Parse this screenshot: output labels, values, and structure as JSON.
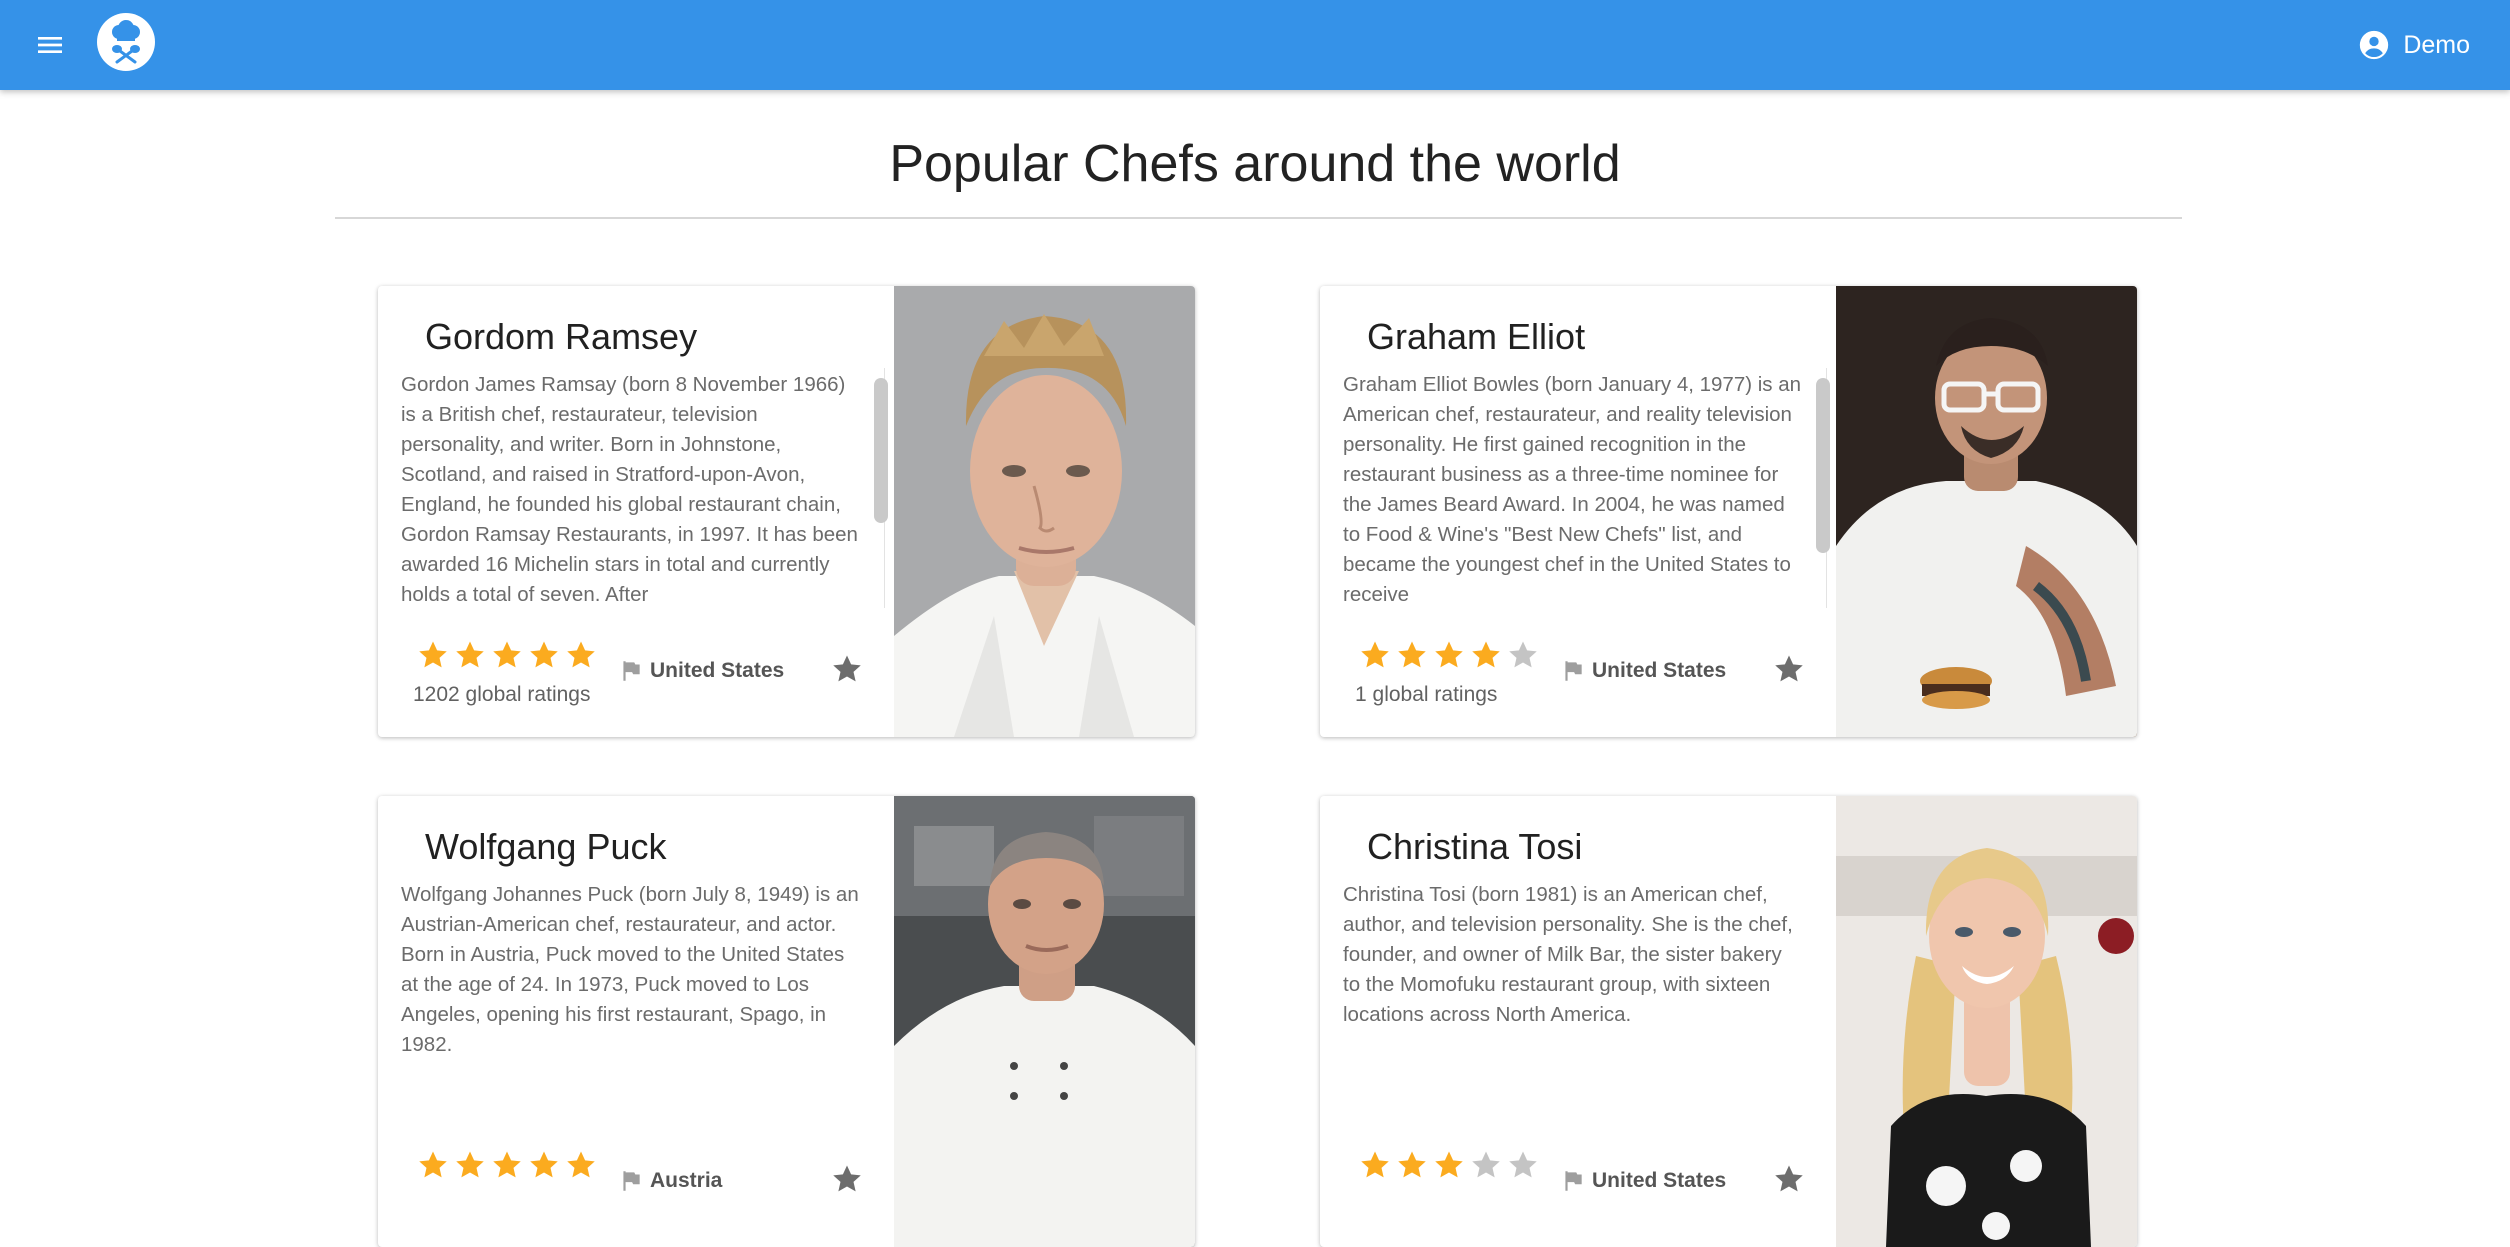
{
  "app": {
    "user_name": "Demo",
    "brand_color": "#3592e8",
    "star_color": "#fbab1f",
    "star_empty_color": "#c4c4c4"
  },
  "page": {
    "title": "Popular Chefs around the world"
  },
  "chefs": [
    {
      "name": "Gordom Ramsey",
      "bio": "Gordon James Ramsay (born 8 November 1966) is a British chef, restaurateur, television personality, and writer. Born in Johnstone, Scotland, and raised in Stratford-upon-Avon, England, he founded his global restaurant chain, Gordon Ramsay Restaurants, in 1997. It has been awarded 16 Michelin stars in total and currently holds a total of seven. After",
      "rating": 5,
      "ratings_text": "1202 global ratings",
      "country": "United States",
      "scrollable": true
    },
    {
      "name": "Graham Elliot",
      "bio": "Graham Elliot Bowles (born January 4, 1977) is an American chef, restaurateur, and reality television personality. He first gained recognition in the restaurant business as a three-time nominee for the James Beard Award. In 2004, he was named to Food & Wine's \"Best New Chefs\" list, and became the youngest chef in the United States to receive",
      "rating": 4,
      "ratings_text": "1 global ratings",
      "country": "United States",
      "scrollable": true
    },
    {
      "name": "Wolfgang Puck",
      "bio": "Wolfgang Johannes Puck (born July 8, 1949) is an Austrian-American chef, restaurateur, and actor. Born in Austria, Puck moved to the United States at the age of 24. In 1973, Puck moved to Los Angeles, opening his first restaurant, Spago, in 1982.",
      "rating": 5,
      "ratings_text": "",
      "country": "Austria",
      "scrollable": false
    },
    {
      "name": "Christina Tosi",
      "bio": "Christina Tosi (born 1981) is an American chef, author, and television personality. She is the chef, founder, and owner of Milk Bar, the sister bakery to the Momofuku restaurant group, with sixteen locations across North America.",
      "rating": 3,
      "ratings_text": "",
      "country": "United States",
      "scrollable": false
    }
  ]
}
